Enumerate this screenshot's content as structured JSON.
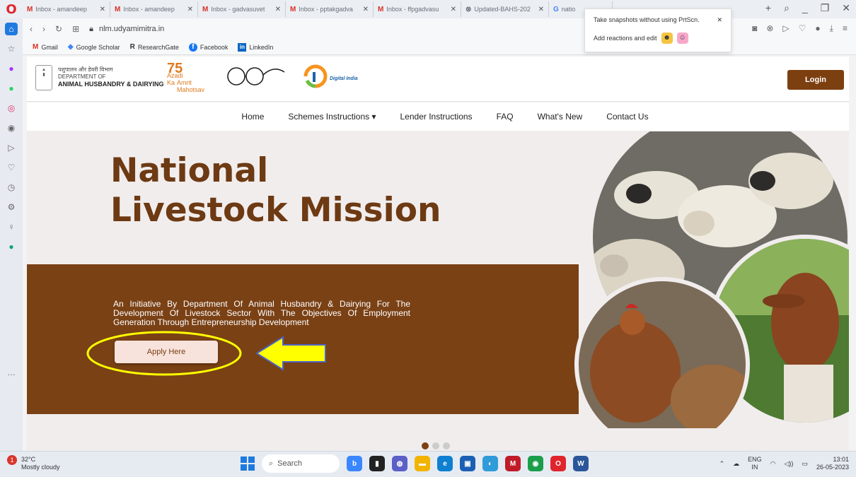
{
  "browser": {
    "logo": "O",
    "tabs": [
      {
        "icon": "M",
        "label": "Inbox - amandeep"
      },
      {
        "icon": "M",
        "label": "Inbox - amandeep"
      },
      {
        "icon": "M",
        "label": "Inbox - gadvasuvet"
      },
      {
        "icon": "M",
        "label": "Inbox - pptakgadva"
      },
      {
        "icon": "M",
        "label": "Inbox - ffpgadvasu"
      },
      {
        "icon": "⊗",
        "label": "Updated-BAHS-202"
      },
      {
        "icon": "G",
        "label": "natio"
      }
    ],
    "url": "nlm.udyamimitra.in",
    "bookmarks": [
      {
        "icon": "M",
        "label": "Gmail"
      },
      {
        "icon": "◆",
        "label": "Google Scholar"
      },
      {
        "icon": "R",
        "label": "ResearchGate"
      },
      {
        "icon": "f",
        "label": "Facebook"
      },
      {
        "icon": "in",
        "label": "LinkedIn"
      }
    ]
  },
  "popup": {
    "text": "Take snapshots without using PrtScn.",
    "action": "Add reactions and edit"
  },
  "site": {
    "dept_hindi": "पशुपालन और डेयरी विभाग",
    "dept_line1": "DEPARTMENT OF",
    "dept_line2": "ANIMAL HUSBANDRY & DAIRYING",
    "azadi_line1": "Azadi",
    "azadi_line2": "Ka",
    "azadi_line3": "Amrit Mahotsav",
    "digital_india": "Digital India",
    "login": "Login",
    "nav": [
      "Home",
      "Schemes Instructions ▾",
      "Lender Instructions",
      "FAQ",
      "What's New",
      "Contact Us"
    ],
    "hero_title_1": "National",
    "hero_title_2": "Livestock Mission",
    "hero_desc": "An Initiative By Department Of Animal Husbandry & Dairying For The Development Of Livestock Sector With The Objectives Of Employment Generation Through Entrepreneurship Development",
    "apply": "Apply Here"
  },
  "taskbar": {
    "weather_temp": "32°C",
    "weather_desc": "Mostly cloudy",
    "notification_count": "1",
    "search": "Search",
    "lang1": "ENG",
    "lang2": "IN",
    "time": "13:01",
    "date": "26-05-2023"
  },
  "colors": {
    "brand_brown": "#7a4115",
    "annotation_yellow": "#ffff00"
  }
}
